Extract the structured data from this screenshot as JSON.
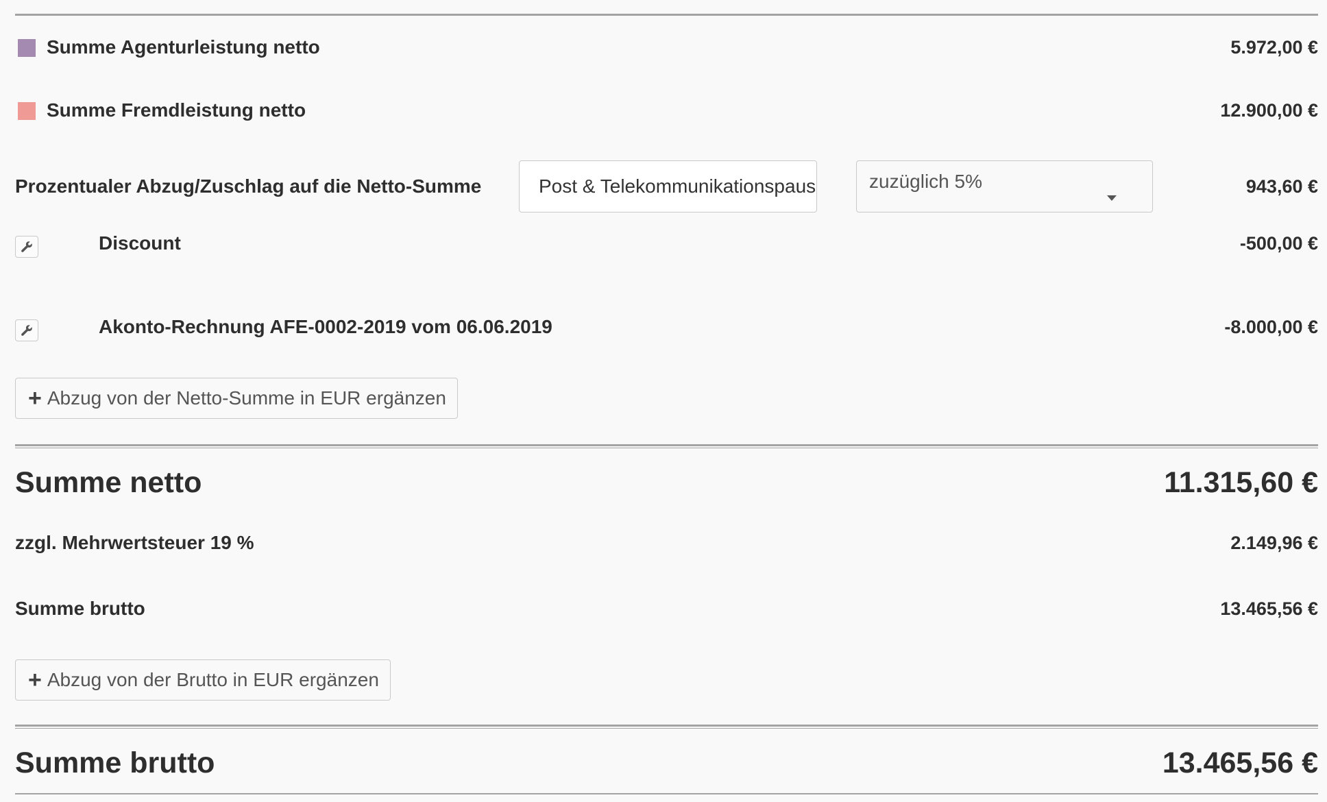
{
  "rows": {
    "agentur": {
      "label": "Summe Agenturleistung netto",
      "amount": "5.972,00 €",
      "color": "#a48ab1"
    },
    "fremd": {
      "label": "Summe Fremdleistung netto",
      "amount": "12.900,00 €",
      "color": "#ef9a94"
    },
    "percent_adjust": {
      "label": "Prozentualer Abzug/Zuschlag auf die Netto-Summe",
      "input_value": "Post & Telekommunikationspauschale",
      "select_value": "zuzüglich 5%",
      "amount": "943,60 €"
    },
    "discount": {
      "label": "Discount",
      "amount": "-500,00 €",
      "icon": "wrench-icon"
    },
    "akonto": {
      "label": "Akonto-Rechnung AFE-0002-2019 vom 06.06.2019",
      "amount": "-8.000,00 €",
      "icon": "wrench-icon"
    }
  },
  "buttons": {
    "add_net_deduction": "Abzug von der Netto-Summe in EUR ergänzen",
    "add_gross_deduction": "Abzug von der Brutto in EUR ergänzen",
    "plus_icon": "plus-icon"
  },
  "totals": {
    "net_label": "Summe netto",
    "net_amount": "11.315,60 €",
    "vat_label": "zzgl. Mehrwertsteuer 19 %",
    "vat_amount": "2.149,96 €",
    "gross_label": "Summe brutto",
    "gross_amount": "13.465,56 €",
    "final_gross_label": "Summe brutto",
    "final_gross_amount": "13.465,56 €"
  }
}
